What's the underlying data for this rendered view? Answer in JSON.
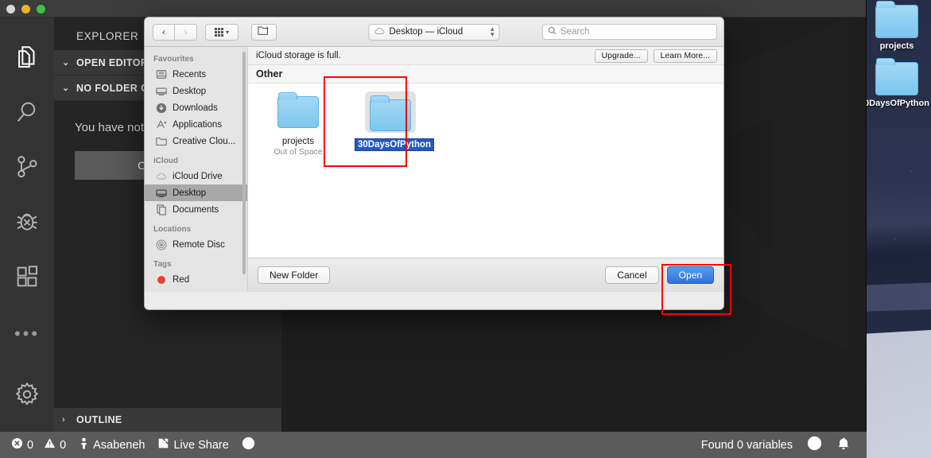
{
  "desktop": {
    "icons": [
      {
        "name": "projects",
        "icon": "folder-icon"
      },
      {
        "name": "0DaysOfPython",
        "icon": "folder-icon"
      }
    ]
  },
  "vscode": {
    "window_controls": {
      "close": "close",
      "minimize": "minimize",
      "zoom": "zoom"
    },
    "activity_bar": [
      {
        "id": "explorer",
        "icon": "files-icon",
        "active": true
      },
      {
        "id": "search",
        "icon": "search-icon",
        "active": false
      },
      {
        "id": "source-control",
        "icon": "source-control-icon",
        "active": false
      },
      {
        "id": "debug",
        "icon": "debug-icon",
        "active": false
      },
      {
        "id": "extensions",
        "icon": "extensions-icon",
        "active": false
      },
      {
        "id": "more",
        "icon": "ellipsis-icon",
        "active": false
      },
      {
        "id": "manage",
        "icon": "gear-icon",
        "active": false
      }
    ],
    "sidebar": {
      "title": "EXPLORER",
      "sections": [
        {
          "label": "OPEN EDITORS",
          "expanded": true
        },
        {
          "label": "NO FOLDER OPENED",
          "expanded": true
        }
      ],
      "message": "You have not yet opened a folder.",
      "open_folder_button": "Open Folder",
      "outline": {
        "label": "OUTLINE",
        "expanded": false
      }
    },
    "status_bar": {
      "errors": "0",
      "warnings": "0",
      "account": "Asabeneh",
      "live_share": "Live Share",
      "clock_icon": "clock-icon",
      "variables": "Found 0 variables",
      "feedback_icon": "smiley-icon",
      "notifications_icon": "bell-icon"
    }
  },
  "dialog": {
    "toolbar": {
      "back": "‹",
      "forward": "›",
      "view_mode": "icon-view-button",
      "new_folder_icon": "new-folder-icon",
      "path_label": "Desktop — iCloud",
      "path_icon": "cloud-icon",
      "search_placeholder": "Search",
      "search_value": "",
      "search_icon": "search-icon"
    },
    "sidebar": {
      "groups": [
        {
          "header": "Favourites",
          "items": [
            {
              "label": "Recents",
              "icon": "recents-icon",
              "selected": false
            },
            {
              "label": "Desktop",
              "icon": "desktop-icon",
              "selected": false
            },
            {
              "label": "Downloads",
              "icon": "downloads-icon",
              "selected": false
            },
            {
              "label": "Applications",
              "icon": "applications-icon",
              "selected": false
            },
            {
              "label": "Creative Clou...",
              "icon": "folder-icon",
              "selected": false
            }
          ]
        },
        {
          "header": "iCloud",
          "items": [
            {
              "label": "iCloud Drive",
              "icon": "cloud-icon",
              "selected": false
            },
            {
              "label": "Desktop",
              "icon": "desktop-icon",
              "selected": true
            },
            {
              "label": "Documents",
              "icon": "documents-icon",
              "selected": false
            }
          ]
        },
        {
          "header": "Locations",
          "items": [
            {
              "label": "Remote Disc",
              "icon": "disc-icon",
              "selected": false
            }
          ]
        },
        {
          "header": "Tags",
          "items": [
            {
              "label": "Red",
              "icon": "red-tag-icon",
              "selected": false
            }
          ]
        }
      ]
    },
    "notice": {
      "text": "iCloud storage is full.",
      "upgrade_button": "Upgrade...",
      "learn_more_button": "Learn More..."
    },
    "group_header": "Other",
    "files": [
      {
        "name": "projects",
        "subtitle": "Out of Space",
        "selected": false,
        "icon": "folder-icon"
      },
      {
        "name": "30DaysOfPython",
        "subtitle": "",
        "selected": true,
        "icon": "folder-icon"
      }
    ],
    "footer": {
      "new_folder": "New Folder",
      "cancel": "Cancel",
      "open": "Open"
    }
  },
  "annotations": {
    "accent_color": "#ff0000",
    "boxes": [
      {
        "id": "selected-folder-highlight"
      },
      {
        "id": "open-button-highlight"
      }
    ]
  }
}
